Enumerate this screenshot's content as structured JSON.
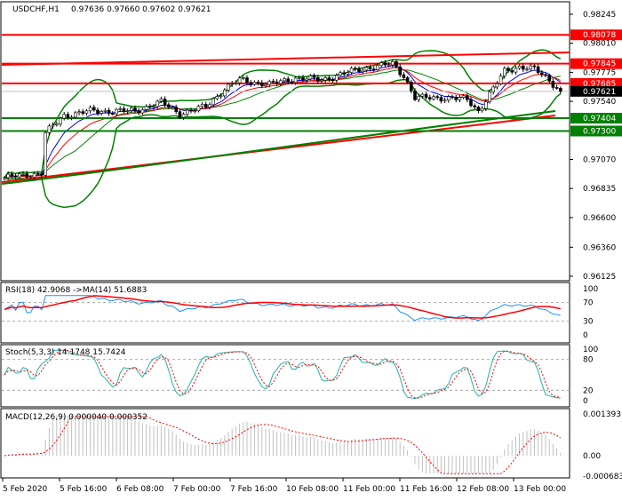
{
  "header": {
    "symbol": "USDCHF,H1",
    "ohlc": "0.97636 0.97660 0.97602 0.97621"
  },
  "colors": {
    "bull": "#000000",
    "bear": "#000000",
    "resistance": "#ff0000",
    "support": "#007f00",
    "bands": "#008000",
    "rsi": "#1e90ff",
    "signal": "#ff0000",
    "stoch": "#20b2aa",
    "hist": "#c0c0c0"
  },
  "chart_data": [
    {
      "type": "candlestick",
      "title": "USDCHF,H1",
      "keypoints": [
        [
          0,
          0.96923
        ],
        [
          10,
          0.96959
        ],
        [
          11,
          0.97282
        ],
        [
          16,
          0.97426
        ],
        [
          23,
          0.97462
        ],
        [
          35,
          0.97462
        ],
        [
          42,
          0.97534
        ],
        [
          47,
          0.9744
        ],
        [
          54,
          0.97498
        ],
        [
          59,
          0.97641
        ],
        [
          63,
          0.97713
        ],
        [
          71,
          0.97677
        ],
        [
          78,
          0.97728
        ],
        [
          85,
          0.97713
        ],
        [
          95,
          0.97799
        ],
        [
          104,
          0.97843
        ],
        [
          107,
          0.97749
        ],
        [
          110,
          0.97569
        ],
        [
          118,
          0.97569
        ],
        [
          124,
          0.97555
        ],
        [
          127,
          0.97462
        ],
        [
          131,
          0.97641
        ],
        [
          134,
          0.97785
        ],
        [
          138,
          0.97821
        ],
        [
          142,
          0.97799
        ],
        [
          146,
          0.97713
        ],
        [
          149,
          0.97621
        ]
      ],
      "ylim": [
        0.96125,
        0.98245
      ],
      "y_ticks": [
        "0.98245",
        "0.98010",
        "0.97775",
        "0.97540",
        "0.97070",
        "0.96835",
        "0.96600",
        "0.96360",
        "0.96125"
      ],
      "levels": [
        {
          "label": "0.98078",
          "value": 0.98078,
          "kind": "resistance"
        },
        {
          "label": "0.97845",
          "value": 0.97845,
          "kind": "resistance"
        },
        {
          "label": "0.97685",
          "value": 0.97685,
          "kind": "resistance"
        },
        {
          "label": "0.97404",
          "value": 0.97404,
          "kind": "support"
        },
        {
          "label": "0.97300",
          "value": 0.973,
          "kind": "support"
        }
      ],
      "current": {
        "label": "0.97621",
        "value": 0.97621
      },
      "x_ticks": [
        "5 Feb 2020",
        "5 Feb 16:00",
        "6 Feb 08:00",
        "7 Feb 00:00",
        "7 Feb 16:00",
        "10 Feb 08:00",
        "11 Feb 00:00",
        "11 Feb 16:00",
        "12 Feb 08:00",
        "13 Feb 00:00"
      ]
    },
    {
      "type": "line",
      "title": "RSI(18) 42.9068  ->MA(14) 51.6883",
      "ylim": [
        0,
        100
      ],
      "y_ticks": [
        "100",
        "70",
        "30",
        "0"
      ]
    },
    {
      "type": "line",
      "title": "Stoch(5,3,3) 14.1748 15.7424",
      "ylim": [
        0,
        100
      ],
      "y_ticks": [
        "100",
        "80",
        "20",
        "0"
      ]
    },
    {
      "type": "bar",
      "title": "MACD(12,26,9) 0.000040 0.000352",
      "ylim": [
        -0.000683,
        0.001393
      ],
      "y_ticks": [
        "0.001393",
        "0.00",
        "-0.000683"
      ]
    }
  ]
}
